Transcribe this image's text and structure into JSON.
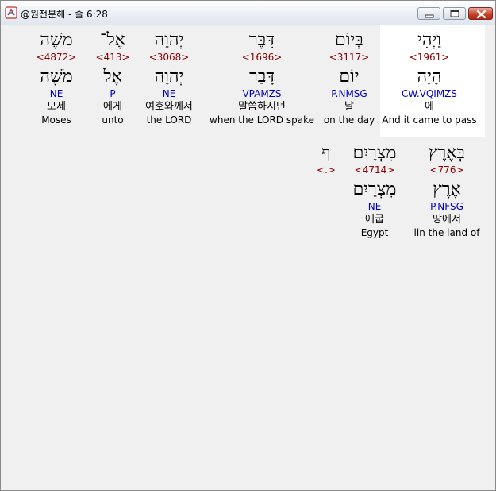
{
  "window": {
    "title": "@원전분해 - 줄 6:28"
  },
  "rows": [
    {
      "words": [
        {
          "surface": "וַיְהִי",
          "strong": "<1961>",
          "lemma": "הָיָה",
          "morph": "CW.VQIMZS",
          "korean": "에",
          "english": "And it came to pass",
          "highlighted": true
        },
        {
          "surface": "בְּיוֹם",
          "strong": "<3117>",
          "lemma": "יוֹם",
          "morph": "P.NMSG",
          "korean": "날",
          "english": "on the day"
        },
        {
          "surface": "דִּבֶּר",
          "strong": "<1696>",
          "lemma": "דָּבַר",
          "morph": "VPAMZS",
          "korean": "말씀하시던",
          "english": "when the LORD spake"
        },
        {
          "surface": "יְהוָה",
          "strong": "<3068>",
          "lemma": "יְהוָה",
          "morph": "NE",
          "korean": "여호와께서",
          "english": "the LORD"
        },
        {
          "surface": "אֶל־",
          "strong": "<413>",
          "lemma": "אֶל",
          "morph": "P",
          "korean": "에게",
          "english": "unto"
        },
        {
          "surface": "מֹשֶׁה",
          "strong": "<4872>",
          "lemma": "מֹשֶׁה",
          "morph": "NE",
          "korean": "모세",
          "english": "Moses"
        }
      ]
    },
    {
      "words": [
        {
          "surface": "בְּאֶרֶץ",
          "strong": "<776>",
          "lemma": "אֶרֶץ",
          "morph": "P.NFSG",
          "korean": "땅에서",
          "english": "lin the land of"
        },
        {
          "surface": "מִצְרָיִם׃",
          "strong": "<4714>",
          "lemma": "מִצְרַיִם",
          "morph": "NE",
          "korean": "애굽",
          "english": "Egypt"
        },
        {
          "surface": "ף",
          "strong": "<.>",
          "lemma": "",
          "morph": "",
          "korean": "",
          "english": ""
        }
      ]
    }
  ]
}
